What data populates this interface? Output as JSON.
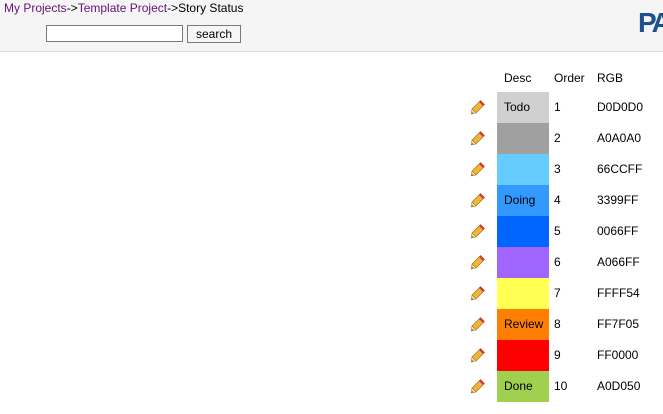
{
  "breadcrumb": {
    "my_projects": "My Projects",
    "sep1": "->",
    "template_project": "Template Project",
    "sep2": "->",
    "current": "Story Status"
  },
  "search": {
    "value": "",
    "button_label": "search"
  },
  "logo": {
    "text": "PA",
    "color": "#1d4f91"
  },
  "table": {
    "headers": {
      "desc": "Desc",
      "order": "Order",
      "rgb": "RGB"
    },
    "rows": [
      {
        "desc": "Todo",
        "order": "1",
        "rgb": "D0D0D0",
        "color": "#D0D0D0"
      },
      {
        "desc": "",
        "order": "2",
        "rgb": "A0A0A0",
        "color": "#A0A0A0"
      },
      {
        "desc": "",
        "order": "3",
        "rgb": "66CCFF",
        "color": "#66CCFF"
      },
      {
        "desc": "Doing",
        "order": "4",
        "rgb": "3399FF",
        "color": "#3399FF"
      },
      {
        "desc": "",
        "order": "5",
        "rgb": "0066FF",
        "color": "#0066FF"
      },
      {
        "desc": "",
        "order": "6",
        "rgb": "A066FF",
        "color": "#A066FF"
      },
      {
        "desc": "",
        "order": "7",
        "rgb": "FFFF54",
        "color": "#FFFF54"
      },
      {
        "desc": "Review",
        "order": "8",
        "rgb": "FF7F05",
        "color": "#FF7F05"
      },
      {
        "desc": "",
        "order": "9",
        "rgb": "FF0000",
        "color": "#FF0000"
      },
      {
        "desc": "Done",
        "order": "10",
        "rgb": "A0D050",
        "color": "#A0D050"
      }
    ]
  },
  "icons": {
    "edit": "pencil-icon",
    "logo": "pa-logo"
  }
}
